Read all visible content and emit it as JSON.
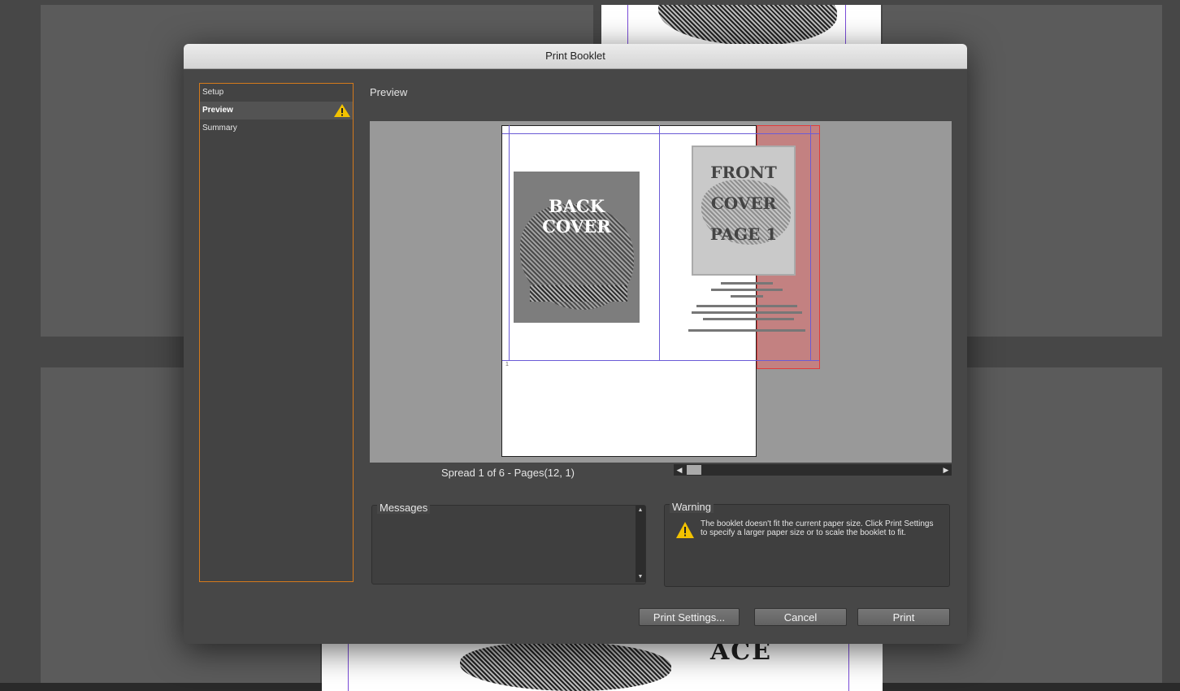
{
  "dialog": {
    "title": "Print Booklet",
    "nav_items": [
      {
        "label": "Setup",
        "active": false,
        "warning": false
      },
      {
        "label": "Preview",
        "active": true,
        "warning": true
      },
      {
        "label": "Summary",
        "active": false,
        "warning": false
      }
    ],
    "preview_heading": "Preview",
    "spread_label": "Spread 1 of 6 - Pages(12, 1)",
    "messages_title": "Messages",
    "warning_title": "Warning",
    "warning_text": "The booklet doesn't fit the current paper size. Click Print Settings to specify a larger paper size or to scale the booklet to fit.",
    "buttons": {
      "print_settings": "Print Settings...",
      "cancel": "Cancel",
      "print": "Print"
    }
  },
  "preview": {
    "back_cover_text": [
      "BACK",
      "COVER"
    ],
    "front_cover_text": [
      "FRONT",
      "COVER",
      "PAGE 1"
    ],
    "bottom_mark": "1"
  },
  "colors": {
    "sidebar_border": "#d47a1c",
    "warning_icon": "#f2c200",
    "bleed_overflow": "#e03c3c",
    "guide": "#6b5bd6"
  },
  "icons": [
    "warning-icon",
    "scroll-left-icon",
    "scroll-right-icon",
    "scroll-up-icon",
    "scroll-down-icon"
  ]
}
